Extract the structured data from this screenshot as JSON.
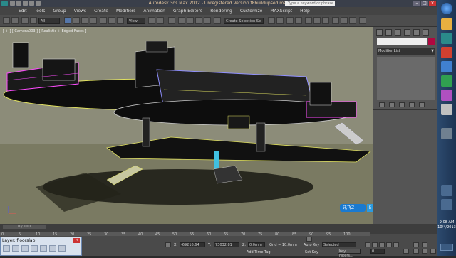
{
  "titlebar": {
    "title": "Autodesk 3ds Max 2012 - Unregistered Version  f8buildupsed.max",
    "search_placeholder": "Type a keyword or phrase",
    "minimize": "–",
    "maximize": "□",
    "close": "×"
  },
  "menu": [
    "Edit",
    "Tools",
    "Group",
    "Views",
    "Create",
    "Modifiers",
    "Animation",
    "Graph Editors",
    "Rendering",
    "Customize",
    "MAXScript",
    "Help"
  ],
  "toolbar": {
    "selection_filter": "All",
    "ref_coord": "View",
    "named_selection": "Create Selection Se"
  },
  "viewport": {
    "label": "[ + ] [ Camera003 ] [ Realistic + Edged Faces ]",
    "accent_colors": {
      "background": "#8c8c79",
      "ground": "#7a7a62",
      "highlight_magenta": "#ff4dff",
      "highlight_yellow": "#e8e860",
      "highlight_cyan": "#40c0e0"
    }
  },
  "command_panel": {
    "modifier_list": "Modifier List",
    "object_color": "#b00840"
  },
  "timeline": {
    "slider": "0 / 100",
    "ticks": [
      "0",
      "5",
      "10",
      "15",
      "20",
      "25",
      "30",
      "35",
      "40",
      "45",
      "50",
      "55",
      "60",
      "65",
      "70",
      "75",
      "80",
      "85",
      "90",
      "95",
      "100"
    ]
  },
  "status": {
    "x_value": "-69216.64",
    "y_value": "73032.81",
    "z_value": "0.0mm",
    "grid": "Grid = 10.0mm",
    "auto_key": "Auto Key",
    "auto_key_value": "Selected",
    "set_key": "Set Key",
    "key_filters": "Key Filters...",
    "add_time_tag": "Add Time Tag",
    "frame": "0"
  },
  "layer_window": {
    "title": "Layer: floorslab"
  },
  "ime": {
    "label": "讯飞Z",
    "key": "5"
  },
  "taskbar": {
    "time": "9:08 AM",
    "date": "10/4/2013"
  }
}
